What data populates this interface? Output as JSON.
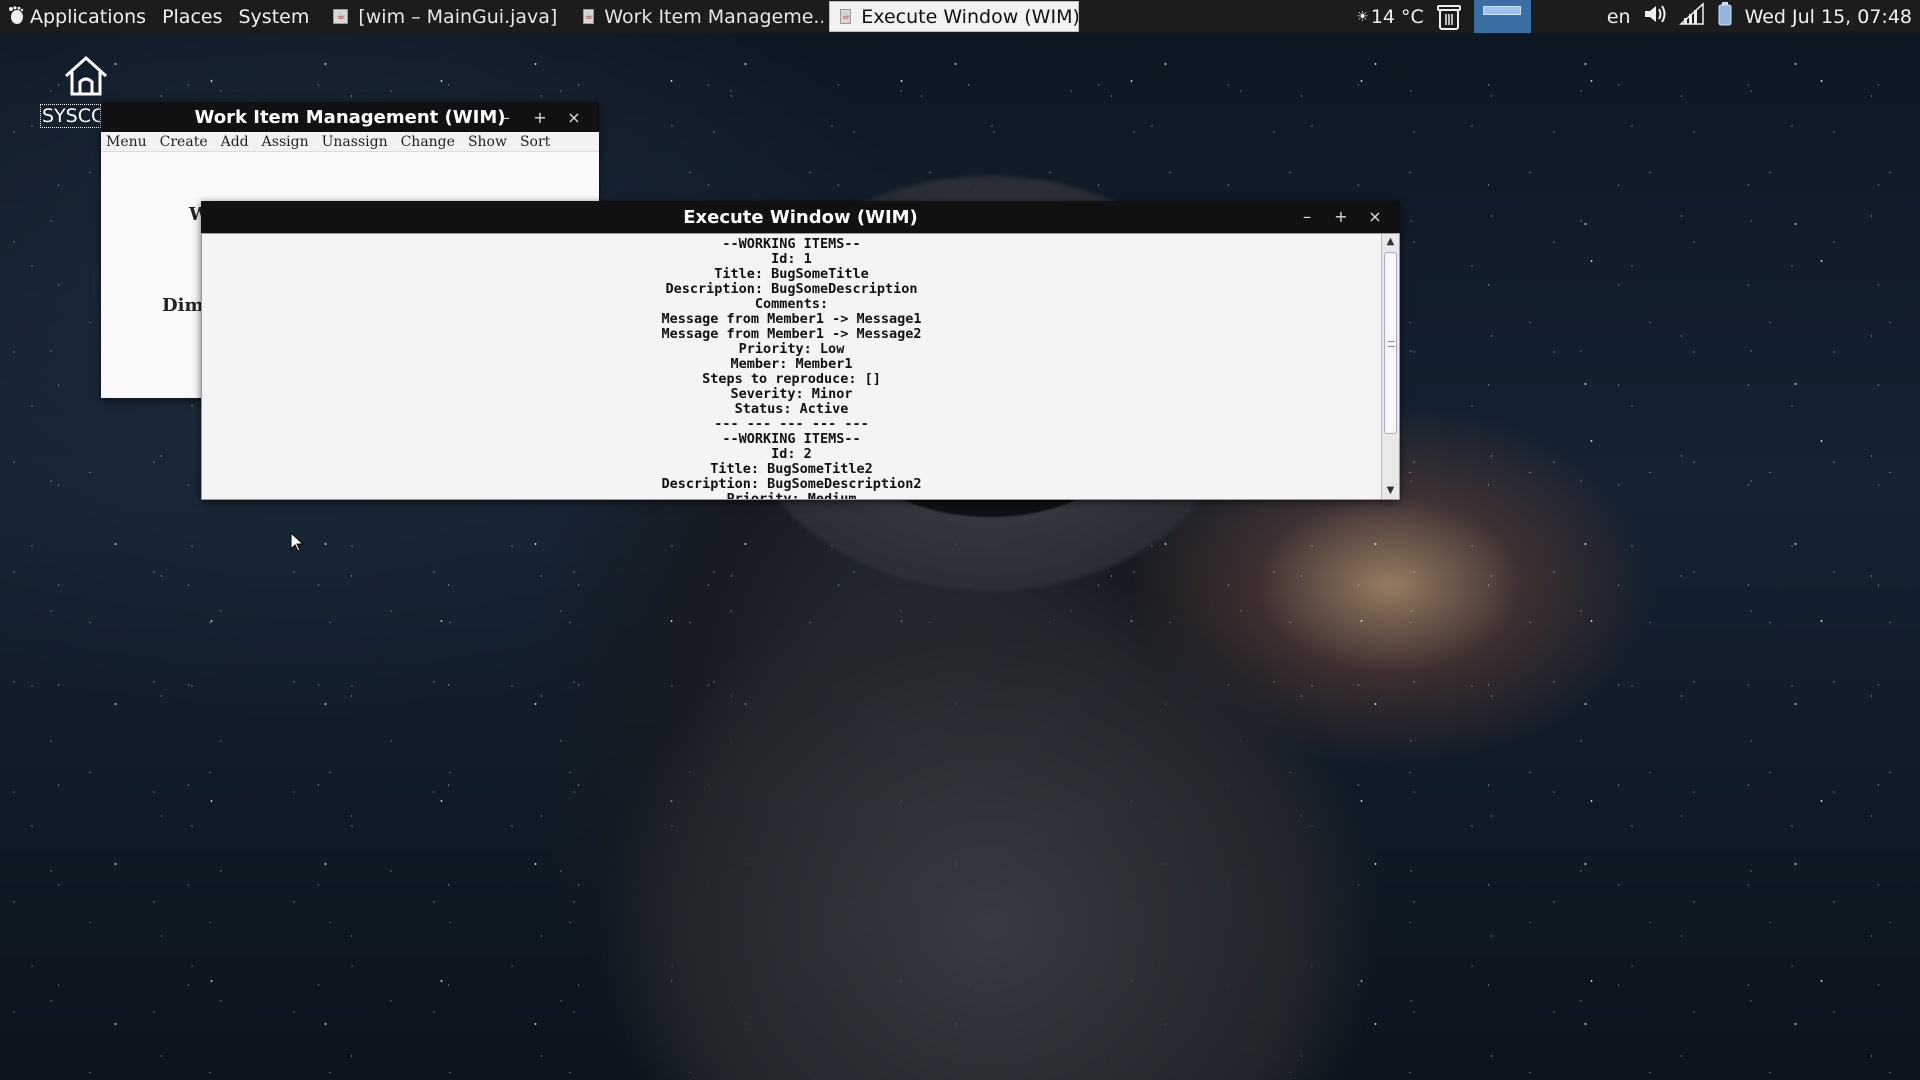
{
  "top_panel": {
    "menus": [
      "Applications",
      "Places",
      "System"
    ],
    "tasks": [
      {
        "label": "[wim – MainGui.java]",
        "active": false
      },
      {
        "label": "Work Item Manageme...",
        "active": false
      },
      {
        "label": "Execute Window (WIM)",
        "active": true
      }
    ],
    "weather": "14 °C",
    "keyboard_layout": "en",
    "clock": "Wed Jul 15, 07:48"
  },
  "desktop": {
    "icon_label": "SYSCC"
  },
  "wim_window": {
    "title": "Work Item Management (WIM)",
    "menu": [
      "Menu",
      "Create",
      "Add",
      "Assign",
      "Unassign",
      "Change",
      "Show",
      "Sort"
    ],
    "visible_fragments": [
      "W",
      "Dim"
    ]
  },
  "execute_window": {
    "title": "Execute Window (WIM)",
    "lines": [
      "--WORKING ITEMS--",
      "Id: 1",
      "Title: BugSomeTitle",
      "Description: BugSomeDescription",
      "Comments:",
      "Message from Member1 -> Message1",
      "Message from Member1 -> Message2",
      "Priority: Low",
      "Member: Member1",
      "Steps to reproduce: []",
      "Severity: Minor",
      "Status: Active",
      "--- --- --- --- ---",
      "--WORKING ITEMS--",
      "Id: 2",
      "Title: BugSomeTitle2",
      "Description: BugSomeDescription2",
      "Priority: Medium"
    ]
  },
  "colors": {
    "panel_bg": "#1c1c1c",
    "titlebar_bg": "#111111",
    "workspace_accent": "#3a6ea5"
  }
}
